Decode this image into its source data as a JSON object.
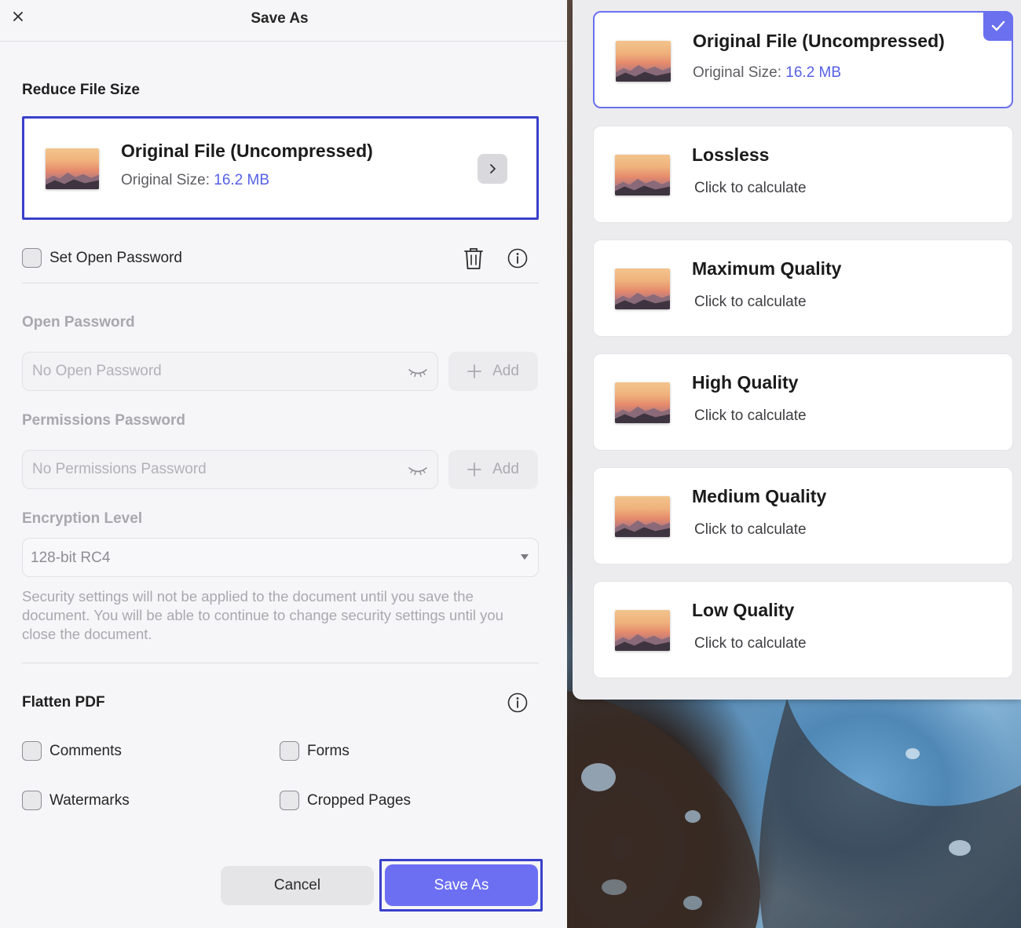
{
  "dialog": {
    "title": "Save As",
    "close_icon": "close-icon"
  },
  "reduce": {
    "heading": "Reduce File Size",
    "card": {
      "title": "Original File (Uncompressed)",
      "size_label": "Original Size:",
      "size_value": "16.2 MB"
    }
  },
  "security": {
    "set_password_label": "Set Open Password",
    "open_password_heading": "Open Password",
    "open_password_placeholder": "No Open Password",
    "permissions_heading": "Permissions Password",
    "permissions_placeholder": "No Permissions Password",
    "add_label": "Add",
    "encryption_heading": "Encryption Level",
    "encryption_value": "128-bit RC4",
    "note": "Security settings will not be applied to the document until you save the document. You will be able to continue to change security settings until you close the document."
  },
  "flatten": {
    "heading": "Flatten PDF",
    "options": [
      "Comments",
      "Forms",
      "Watermarks",
      "Cropped Pages"
    ]
  },
  "buttons": {
    "cancel": "Cancel",
    "save": "Save As"
  },
  "quality_options": [
    {
      "title": "Original File (Uncompressed)",
      "sub_label": "Original Size:",
      "sub_value": "16.2 MB",
      "selected": true
    },
    {
      "title": "Lossless",
      "sub_label": "Click to calculate"
    },
    {
      "title": "Maximum Quality",
      "sub_label": "Click to calculate"
    },
    {
      "title": "High Quality",
      "sub_label": "Click to calculate"
    },
    {
      "title": "Medium Quality",
      "sub_label": "Click to calculate"
    },
    {
      "title": "Low Quality",
      "sub_label": "Click to calculate"
    }
  ],
  "colors": {
    "accent": "#5560e6",
    "primary_button": "#6c6ff2",
    "focus_outline": "#3a40c9"
  }
}
